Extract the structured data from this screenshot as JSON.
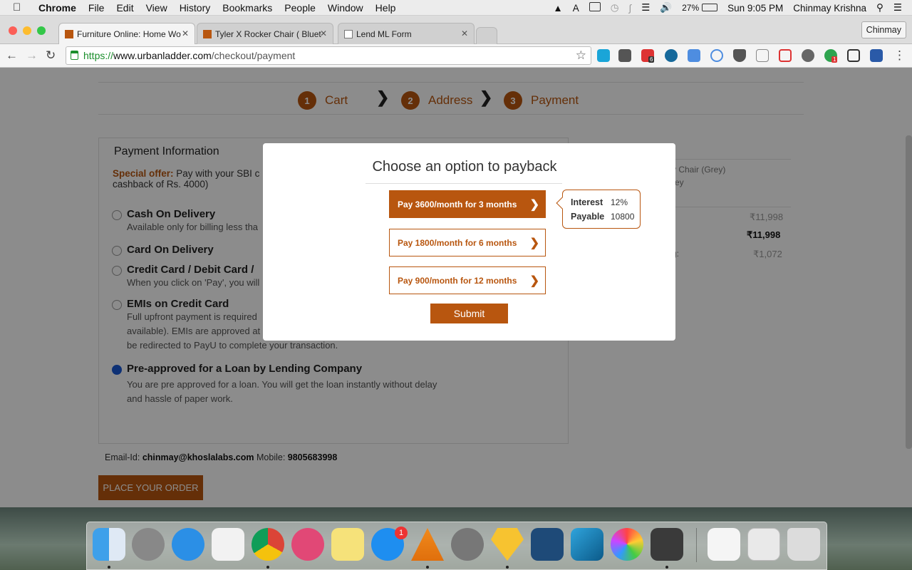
{
  "menubar": {
    "app": "Chrome",
    "items": [
      "File",
      "Edit",
      "View",
      "History",
      "Bookmarks",
      "People",
      "Window",
      "Help"
    ],
    "battery": "27%",
    "clock": "Sun 9:05 PM",
    "user": "Chinmay Krishna"
  },
  "tabs": [
    {
      "label": "Furniture Online: Home Wo",
      "active": true
    },
    {
      "label": "Tyler X Rocker Chair ( Bluet",
      "active": false
    },
    {
      "label": "Lend ML Form",
      "active": false
    }
  ],
  "profile": "Chinmay",
  "url": {
    "scheme": "https://",
    "host": "www.urbanladder.com",
    "path": "/checkout/payment"
  },
  "extensions": {
    "badge1": "6",
    "badge2": "1"
  },
  "steps": [
    {
      "num": "1",
      "label": "Cart"
    },
    {
      "num": "2",
      "label": "Address"
    },
    {
      "num": "3",
      "label": "Payment"
    }
  ],
  "payment": {
    "heading": "Payment Information",
    "offer_label": "Special offer:",
    "offer_text_1": "Pay with your SBI c",
    "offer_text_2": "cashback of Rs. 4000)",
    "options": [
      {
        "title": "Cash On Delivery",
        "desc": "Available only for billing less tha"
      },
      {
        "title": "Card On Delivery",
        "desc": ""
      },
      {
        "title": "Credit Card / Debit Card /",
        "desc": "When you click on 'Pay', you will"
      },
      {
        "title": "EMIs on Credit Card",
        "desc1": "Full upfront payment is required",
        "desc2": "available). EMIs are approved at",
        "desc3": "be redirected to PayU to complete your transaction."
      },
      {
        "title": "Pre-approved for a Loan by Lending Company",
        "desc1": "You are pre approved for a loan. You will get the loan instantly without delay",
        "desc2": "and hassle of paper work.",
        "selected": true
      }
    ]
  },
  "summary": {
    "item": "y Chair (Grey)",
    "item2": "rey",
    "price1": "₹11,998",
    "total": "₹11,998",
    "saving_label": "g:",
    "saving": "₹1,072"
  },
  "contact": {
    "email_label": "Email-Id:",
    "email": "chinmay@khoslalabs.com",
    "mobile_label": "Mobile:",
    "mobile": "9805683998"
  },
  "place_order": "PLACE YOUR ORDER",
  "modal": {
    "title": "Choose an option to payback",
    "plans": [
      {
        "label": "Pay 3600/month for 3 months",
        "selected": true
      },
      {
        "label": "Pay 1800/month for 6 months",
        "selected": false
      },
      {
        "label": "Pay 900/month for 12 months",
        "selected": false
      }
    ],
    "tooltip": {
      "interest_label": "Interest",
      "interest": "12%",
      "payable_label": "Payable",
      "payable": "10800"
    },
    "submit": "Submit"
  },
  "dock": {
    "appstore_badge": "1"
  },
  "colors": {
    "accent": "#b8560f",
    "radio_selected": "#1a5ad6"
  }
}
